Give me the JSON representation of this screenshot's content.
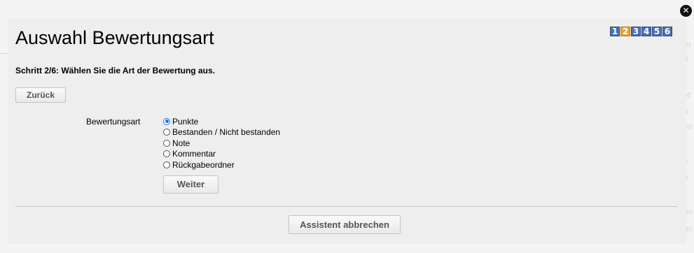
{
  "background": {
    "snippets": [
      "tu",
      "ß",
      "et",
      "n",
      "en",
      "e",
      "a",
      "nn",
      "nn"
    ]
  },
  "dialog": {
    "close_symbol": "✕",
    "title": "Auswahl Bewertungsart",
    "steps": [
      "1",
      "2",
      "3",
      "4",
      "5",
      "6"
    ],
    "active_step": 2,
    "subtitle": "Schritt 2/6: Wählen Sie die Art der Bewertung aus.",
    "back_label": "Zurück",
    "field_label": "Bewertungsart",
    "options": [
      {
        "label": "Punkte",
        "checked": true
      },
      {
        "label": "Bestanden / Nicht bestanden",
        "checked": false
      },
      {
        "label": "Note",
        "checked": false
      },
      {
        "label": "Kommentar",
        "checked": false
      },
      {
        "label": "Rückgabeordner",
        "checked": false
      }
    ],
    "next_label": "Weiter",
    "cancel_label": "Assistent abbrechen"
  },
  "colors": {
    "step_default": "#4a6fb4",
    "step_active": "#f0a22c",
    "radio_checked": "#1a73e8"
  }
}
